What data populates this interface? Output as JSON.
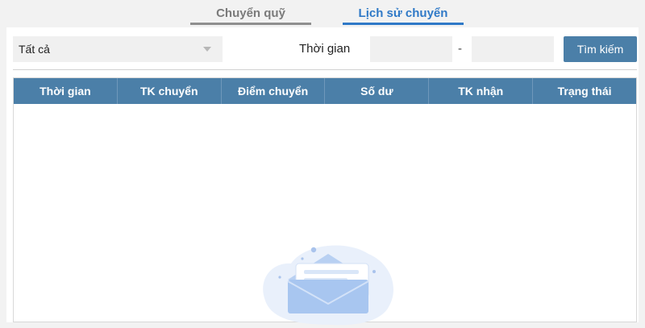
{
  "tabs": [
    {
      "label": "Chuyển quỹ",
      "active": false
    },
    {
      "label": "Lịch sử chuyển",
      "active": true
    }
  ],
  "filter": {
    "select_value": "Tất cả",
    "time_label": "Thời gian",
    "date_from": "",
    "date_to": "",
    "dash": "-",
    "search_label": "Tìm kiếm"
  },
  "table": {
    "columns": [
      "Thời gian",
      "TK chuyển",
      "Điểm chuyển",
      "Số dư",
      "TK nhận",
      "Trạng thái"
    ],
    "rows": []
  },
  "colors": {
    "header_bg": "#4b7fa8",
    "active_tab": "#2f79c7",
    "inactive_tab": "#7b7b7b"
  },
  "icons": {
    "empty_state": "empty-mail-icon",
    "dropdown": "chevron-down-icon"
  }
}
